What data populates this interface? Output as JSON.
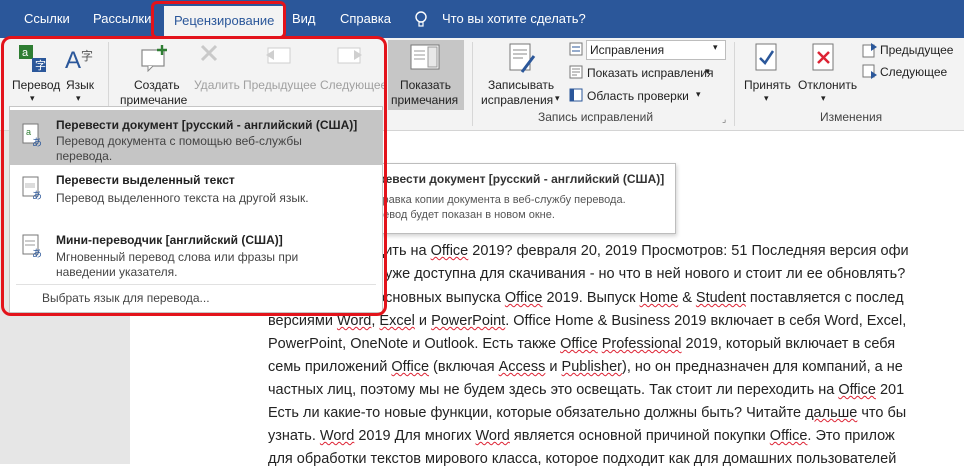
{
  "tabs": [
    "Ссылки",
    "Рассылки",
    "Рецензирование",
    "Вид",
    "Справка"
  ],
  "tell_me": "Что вы хотите сделать?",
  "ribbon": {
    "translate": "Перевод",
    "language": "Язык",
    "new_comment_1": "Создать",
    "new_comment_2": "примечание",
    "delete": "Удалить",
    "previous_comment": "Предыдущее",
    "next_comment": "Следующее",
    "show_comments_1": "Показать",
    "show_comments_2": "примечания",
    "track_changes_1": "Записывать",
    "track_changes_2": "исправления",
    "markup_select": "Исправления",
    "show_markup": "Показать исправления",
    "reviewing_pane": "Область проверки",
    "group_tracking": "Запись исправлений",
    "accept": "Принять",
    "reject": "Отклонить",
    "previous_change": "Предыдущее",
    "next_change": "Следующее",
    "group_changes": "Изменения"
  },
  "menu": {
    "item1_title": "Перевести документ [русский - английский (США)]",
    "item1_desc1": "Перевод документа с помощью веб-службы",
    "item1_desc2": "перевода.",
    "item2_title": "Перевести выделенный текст",
    "item2_desc": "Перевод выделенного текста на другой язык.",
    "item3_title": "Мини-переводчик [английский (США)]",
    "item3_desc1": "Мгновенный перевод слова или фразы при",
    "item3_desc2": "наведении указателя.",
    "choose_language": "Выбрать язык для перевода..."
  },
  "tooltip": {
    "title": "Перевести документ [русский - английский (США)]",
    "line1": "Отправка копии документа в веб-службу перевода.",
    "line2": "Перевод будет показан в новом окне."
  },
  "doc": {
    "l1a": "одить на ",
    "l1b": "Office",
    "l1c": " 2019? февраля 20, 2019 Просмотров: 51 Последняя версия офи",
    "l2a": "уже доступна для скачивания - но что в ней нового и стоит ли ее обновлять?",
    "l3a": "основных выпуска ",
    "l3b": "Office",
    "l3c": " 2019. Выпуск ",
    "l3d": "Home",
    "l3e": " & ",
    "l3f": "Student",
    "l3g": " поставляется с послед",
    "l4a": "версиями ",
    "l4b": "Word",
    "l4c": ", ",
    "l4d": "Excel",
    "l4e": " и ",
    "l4f": "PowerPoint",
    "l4g": ". Office Home & Business 2019 включает в себя Word, Excel,",
    "l5a": "PowerPoint, OneNote и Outlook. Есть также ",
    "l5b": "Office",
    "l5c": " ",
    "l5d": "Professional",
    "l5e": " 2019, который включает в себя",
    "l6a": "семь приложений ",
    "l6b": "Office",
    "l6c": " (включая ",
    "l6d": "Access",
    "l6e": " и ",
    "l6f": "Publisher",
    "l6g": "), но он предназначен для компаний, а не",
    "l7a": "частных лиц, поэтому мы не будем здесь это освещать. Так стоит ли переходить на ",
    "l7b": "Office",
    "l7c": " 201",
    "l8a": "Есть ли какие-то новые функции, которые обязательно должны быть? Читайте ",
    "l8b": "дальше",
    "l8c": " что бы",
    "l9a": "узнать.   ",
    "l9b": "Word",
    "l9c": " 2019 Для многих ",
    "l9d": "Word",
    "l9e": " является основной причиной покупки ",
    "l9f": "Office",
    "l9g": ". Это прилож",
    "l10a": "для обработки текстов мирового класса, которое подходит как для домашних пользователей"
  },
  "colors": {
    "ribbon_blue": "#2b579a",
    "highlight_red": "#e3131b"
  }
}
